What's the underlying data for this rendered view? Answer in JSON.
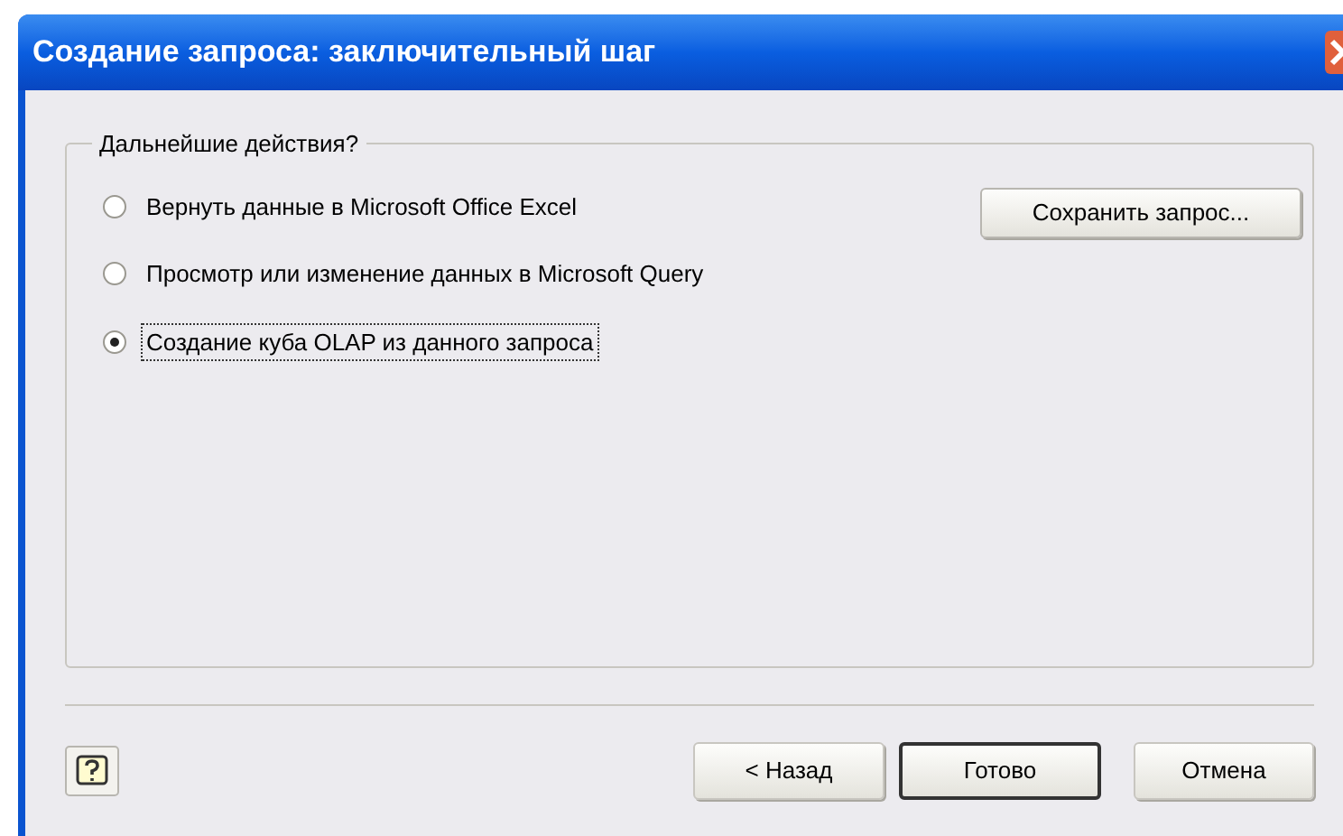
{
  "window": {
    "title": "Создание запроса: заключительный шаг"
  },
  "group": {
    "legend": "Дальнейшие действия?"
  },
  "options": [
    {
      "label": "Вернуть данные в Microsoft Office Excel",
      "selected": false
    },
    {
      "label": "Просмотр или изменение данных в Microsoft Query",
      "selected": false
    },
    {
      "label": "Создание куба OLAP из данного запроса",
      "selected": true
    }
  ],
  "save_button": "Сохранить запрос...",
  "buttons": [
    {
      "label": "< Назад",
      "default": false
    },
    {
      "label": "Готово",
      "default": true
    },
    {
      "label": "Отмена",
      "default": false
    }
  ]
}
